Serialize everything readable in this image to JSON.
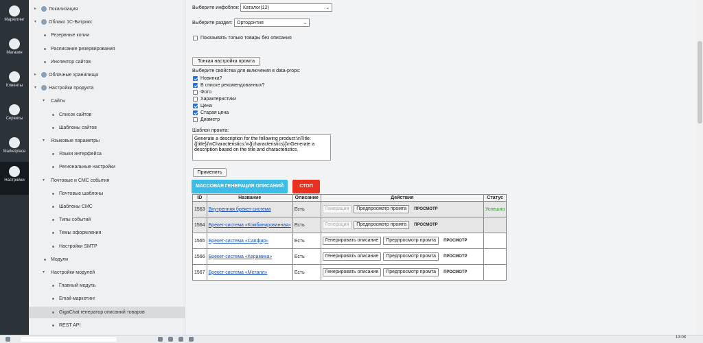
{
  "iconbar": [
    {
      "label": "Маркетинг",
      "icon": "target-icon"
    },
    {
      "label": "Магазин",
      "icon": "cart-icon"
    },
    {
      "label": "Клиенты",
      "icon": "clients-icon"
    },
    {
      "label": "Сервисы",
      "icon": "layers-icon"
    },
    {
      "label": "Marketplace",
      "icon": "cloud-download-icon"
    },
    {
      "label": "Настройки",
      "icon": "gear-icon"
    }
  ],
  "menu": [
    {
      "label": "Локализация",
      "level": 1,
      "expand": "▸",
      "icon": "globe-icon"
    },
    {
      "label": "Облако 1С-Битрикс",
      "level": 1,
      "expand": "▾",
      "icon": "cloud-icon"
    },
    {
      "label": "Резервные копии",
      "level": 2
    },
    {
      "label": "Расписание резервирования",
      "level": 2
    },
    {
      "label": "Инспектор сайтов",
      "level": 2
    },
    {
      "label": "Облачные хранилища",
      "level": 1,
      "expand": "▸",
      "icon": "storage-icon"
    },
    {
      "label": "Настройки продукта",
      "level": 1,
      "expand": "▾",
      "icon": "settings-icon"
    },
    {
      "label": "Сайты",
      "level": 2,
      "expand": "▾"
    },
    {
      "label": "Список сайтов",
      "level": 3
    },
    {
      "label": "Шаблоны сайтов",
      "level": 3
    },
    {
      "label": "Языковые параметры",
      "level": 2,
      "expand": "▾"
    },
    {
      "label": "Языки интерфейса",
      "level": 3
    },
    {
      "label": "Региональные настройки",
      "level": 3
    },
    {
      "label": "Почтовые и СМС события",
      "level": 2,
      "expand": "▾"
    },
    {
      "label": "Почтовые шаблоны",
      "level": 3
    },
    {
      "label": "Шаблоны СМС",
      "level": 3
    },
    {
      "label": "Типы событий",
      "level": 3
    },
    {
      "label": "Темы оформления",
      "level": 3
    },
    {
      "label": "Настройки SMTP",
      "level": 3
    },
    {
      "label": "Модули",
      "level": 2
    },
    {
      "label": "Настройки модулей",
      "level": 2,
      "expand": "▾"
    },
    {
      "label": "Главный модуль",
      "level": 3
    },
    {
      "label": "Email-маркетинг",
      "level": 3
    },
    {
      "label": "GigaChat генератор описаний товаров",
      "level": 3,
      "selected": true
    },
    {
      "label": "REST API",
      "level": 3
    }
  ],
  "form": {
    "iblock_label": "Выберите инфоблок:",
    "iblock_value": "Каталог(12)",
    "section_label": "Выберите раздел:",
    "section_value": "Ортодонтия",
    "only_without_desc": "Показывать только товары без описания",
    "fine_tune_btn": "Тонкая настройка промта",
    "props_label": "Выберите свойства для включения в data-props:",
    "props": [
      {
        "label": "Новинка?",
        "checked": true
      },
      {
        "label": "В списке рекомендованных?",
        "checked": true
      },
      {
        "label": "Фото",
        "checked": false
      },
      {
        "label": "Характеристики",
        "checked": false
      },
      {
        "label": "Цена",
        "checked": true
      },
      {
        "label": "Старая цена",
        "checked": true
      },
      {
        "label": "Диаметр",
        "checked": false
      }
    ],
    "template_label": "Шаблон промта:",
    "template_value": "Generate a description for the following product:\\nTitle: {{title}}\\nCharacteristics:\\n{{characteristics}}\\nGenerate a description based on the title and characteristics.",
    "apply_btn": "Применить",
    "mass_btn": "МАССОВАЯ ГЕНЕРАЦИЯ ОПИСАНИЙ",
    "stop_btn": "СТОП"
  },
  "table": {
    "headers": [
      "ID",
      "Название",
      "Описание",
      "Действия",
      "Статус"
    ],
    "rows": [
      {
        "id": "1563",
        "name": "Внутренняя брекет-система",
        "desc": "Есть",
        "done": true,
        "status": "Успешно"
      },
      {
        "id": "1564",
        "name": "Брекет-система «Комбинированная»",
        "desc": "Есть",
        "done": true,
        "status": ""
      },
      {
        "id": "1565",
        "name": "Брекет-система «Сапфир»",
        "desc": "Есть",
        "done": false,
        "status": ""
      },
      {
        "id": "1566",
        "name": "Брекет-система «Керамика»",
        "desc": "Есть",
        "done": false,
        "status": ""
      },
      {
        "id": "1567",
        "name": "Брекет-система «Металл»",
        "desc": "Есть",
        "done": false,
        "status": ""
      }
    ],
    "btn_generate_short": "Генерация",
    "btn_generate": "Генерировать описание",
    "btn_preview": "Предпросмотр промта",
    "btn_view": "ПРОСМОТР"
  },
  "taskbar": {
    "time": "13:08"
  }
}
